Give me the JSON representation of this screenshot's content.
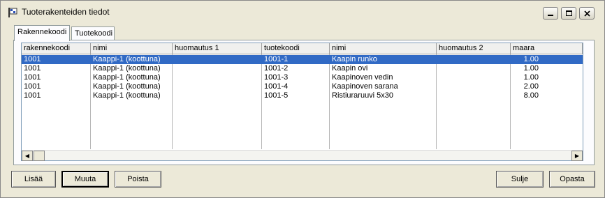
{
  "window": {
    "title": "Tuoterakenteiden tiedot",
    "controls": [
      "minimize",
      "maximize",
      "close"
    ]
  },
  "tabs": [
    {
      "label": "Rakennekoodi",
      "active": true
    },
    {
      "label": "Tuotekoodi",
      "active": false
    }
  ],
  "grid": {
    "headers": [
      "rakennekoodi",
      "nimi",
      "huomautus 1",
      "tuotekoodi",
      "nimi",
      "huomautus 2",
      "maara"
    ],
    "rows": [
      [
        "1001",
        "Kaappi-1 (koottuna)",
        "",
        "1001-1",
        "Kaapin runko",
        "",
        "1.00"
      ],
      [
        "1001",
        "Kaappi-1 (koottuna)",
        "",
        "1001-2",
        "Kaapin ovi",
        "",
        "1.00"
      ],
      [
        "1001",
        "Kaappi-1 (koottuna)",
        "",
        "1001-3",
        "Kaapinoven vedin",
        "",
        "1.00"
      ],
      [
        "1001",
        "Kaappi-1 (koottuna)",
        "",
        "1001-4",
        "Kaapinoven sarana",
        "",
        "2.00"
      ],
      [
        "1001",
        "Kaappi-1 (koottuna)",
        "",
        "1001-5",
        "Ristiuraruuvi 5x30",
        "",
        "8.00"
      ]
    ],
    "selected_row": 0
  },
  "buttons": {
    "add": "Lisää",
    "edit": "Muuta",
    "delete": "Poista",
    "close": "Sulje",
    "help": "Opasta"
  },
  "colors": {
    "selection": "#316ac5",
    "window_bg": "#ece9d8"
  }
}
